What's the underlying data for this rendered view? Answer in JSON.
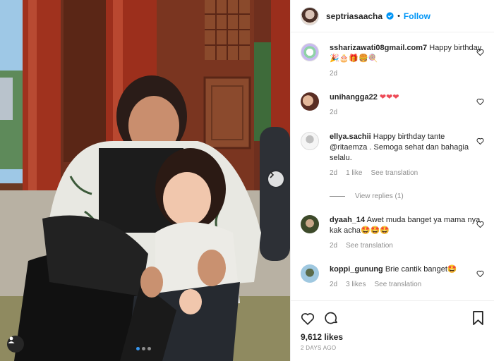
{
  "post": {
    "username": "septriasaacha",
    "separator": "•",
    "follow_label": "Follow",
    "likes": "9,612 likes",
    "date": "2 DAYS AGO",
    "carousel": {
      "count": 3,
      "active": 1
    }
  },
  "comments": [
    {
      "username": "ssharizawati08gmail.com7",
      "text": "Happy birthday 🎉🎂🎁🍔🍭",
      "age": "2d",
      "likes": "",
      "translate": ""
    },
    {
      "username": "unihangga22",
      "text": "❤❤❤",
      "age": "2d",
      "likes": "",
      "translate": ""
    },
    {
      "username": "ellya.sachii",
      "text": "Happy birthday tante @ritaemza . Semoga sehat dan bahagia selalu.",
      "age": "2d",
      "likes": "1 like",
      "translate": "See translation"
    },
    {
      "username": "dyaah_14",
      "text": "Awet muda banget ya mama nya kak acha🤩🤩🤩",
      "age": "2d",
      "likes": "",
      "translate": "See translation"
    },
    {
      "username": "koppi_gunung",
      "text": "Brie cantik banget🤩",
      "age": "2d",
      "likes": "3 likes",
      "translate": "See translation"
    }
  ],
  "view_replies": "View replies (1)",
  "colors": {
    "link": "#0095f6",
    "muted": "#8e8e8e",
    "heart": "#ed4956",
    "dot_active": "#3897f0"
  },
  "icons": [
    "verified-badge-icon",
    "heart-icon",
    "comment-icon",
    "bookmark-icon",
    "chevron-right-icon",
    "user-tag-icon"
  ]
}
